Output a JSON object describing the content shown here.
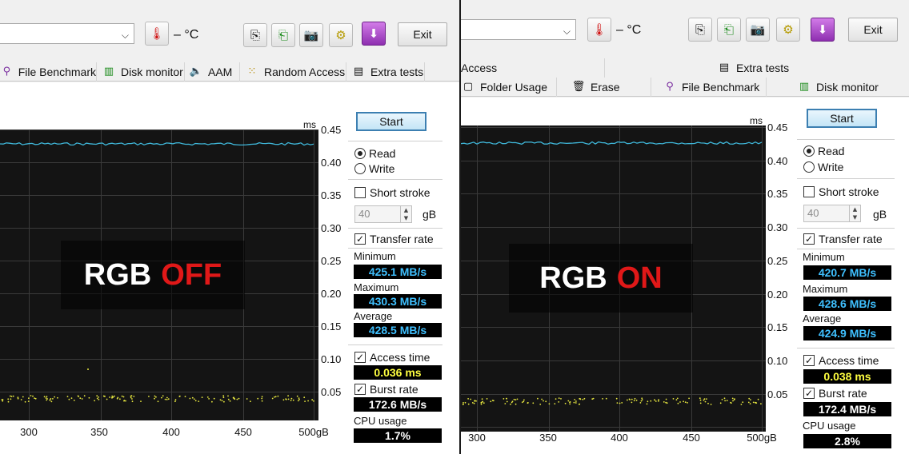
{
  "left": {
    "toolbar": {
      "temperature": "– °C",
      "exit_label": "Exit"
    },
    "tabs": [
      "File Benchmark",
      "Disk monitor",
      "AAM",
      "Random Access",
      "Extra tests"
    ],
    "overlay": {
      "prefix": "RGB",
      "state": "OFF"
    },
    "graph": {
      "unit": "ms",
      "y_ticks": [
        "0.45",
        "0.40",
        "0.35",
        "0.30",
        "0.25",
        "0.20",
        "0.15",
        "0.10",
        "0.05"
      ],
      "x_ticks": [
        "300",
        "350",
        "400",
        "450",
        "500gB"
      ]
    },
    "controls": {
      "start_label": "Start",
      "read_label": "Read",
      "write_label": "Write",
      "short_stroke_label": "Short stroke",
      "stroke_value": "40",
      "stroke_unit": "gB",
      "transfer_rate_label": "Transfer rate",
      "minimum_label": "Minimum",
      "minimum_value": "425.1 MB/s",
      "maximum_label": "Maximum",
      "maximum_value": "430.3 MB/s",
      "average_label": "Average",
      "average_value": "428.5 MB/s",
      "access_time_label": "Access time",
      "access_time_value": "0.036 ms",
      "burst_rate_label": "Burst rate",
      "burst_rate_value": "172.6 MB/s",
      "cpu_usage_label": "CPU usage",
      "cpu_usage_value": "1.7%"
    }
  },
  "right": {
    "toolbar": {
      "temperature": "– °C",
      "exit_label": "Exit"
    },
    "tabs_top": [
      "Access",
      "Extra tests"
    ],
    "tabs_bottom": [
      "Folder Usage",
      "Erase",
      "File Benchmark",
      "Disk monitor"
    ],
    "overlay": {
      "prefix": "RGB",
      "state": "ON"
    },
    "graph": {
      "unit": "ms",
      "y_ticks": [
        "0.45",
        "0.40",
        "0.35",
        "0.30",
        "0.25",
        "0.20",
        "0.15",
        "0.10",
        "0.05"
      ],
      "x_ticks": [
        "300",
        "350",
        "400",
        "450",
        "500gB"
      ]
    },
    "controls": {
      "start_label": "Start",
      "read_label": "Read",
      "write_label": "Write",
      "short_stroke_label": "Short stroke",
      "stroke_value": "40",
      "stroke_unit": "gB",
      "transfer_rate_label": "Transfer rate",
      "minimum_label": "Minimum",
      "minimum_value": "420.7 MB/s",
      "maximum_label": "Maximum",
      "maximum_value": "428.6 MB/s",
      "average_label": "Average",
      "average_value": "424.9 MB/s",
      "access_time_label": "Access time",
      "access_time_value": "0.038 ms",
      "burst_rate_label": "Burst rate",
      "burst_rate_value": "172.4 MB/s",
      "cpu_usage_label": "CPU usage",
      "cpu_usage_value": "2.8%"
    }
  },
  "colors": {
    "transfer_line": "#3fb6d8",
    "access_dots": "#e8e840",
    "graph_bg": "#141414",
    "grid": "#3a3a3a",
    "state_red": "#e01818",
    "value_blue": "#3fc0ff"
  },
  "icons": [
    "thermometer-icon",
    "copy-icon",
    "paste-icon",
    "camera-icon",
    "wrench-icon",
    "download-icon",
    "file-benchmark-icon",
    "disk-monitor-icon",
    "speaker-icon",
    "random-access-icon",
    "extra-tests-icon",
    "folder-icon",
    "erase-icon"
  ]
}
